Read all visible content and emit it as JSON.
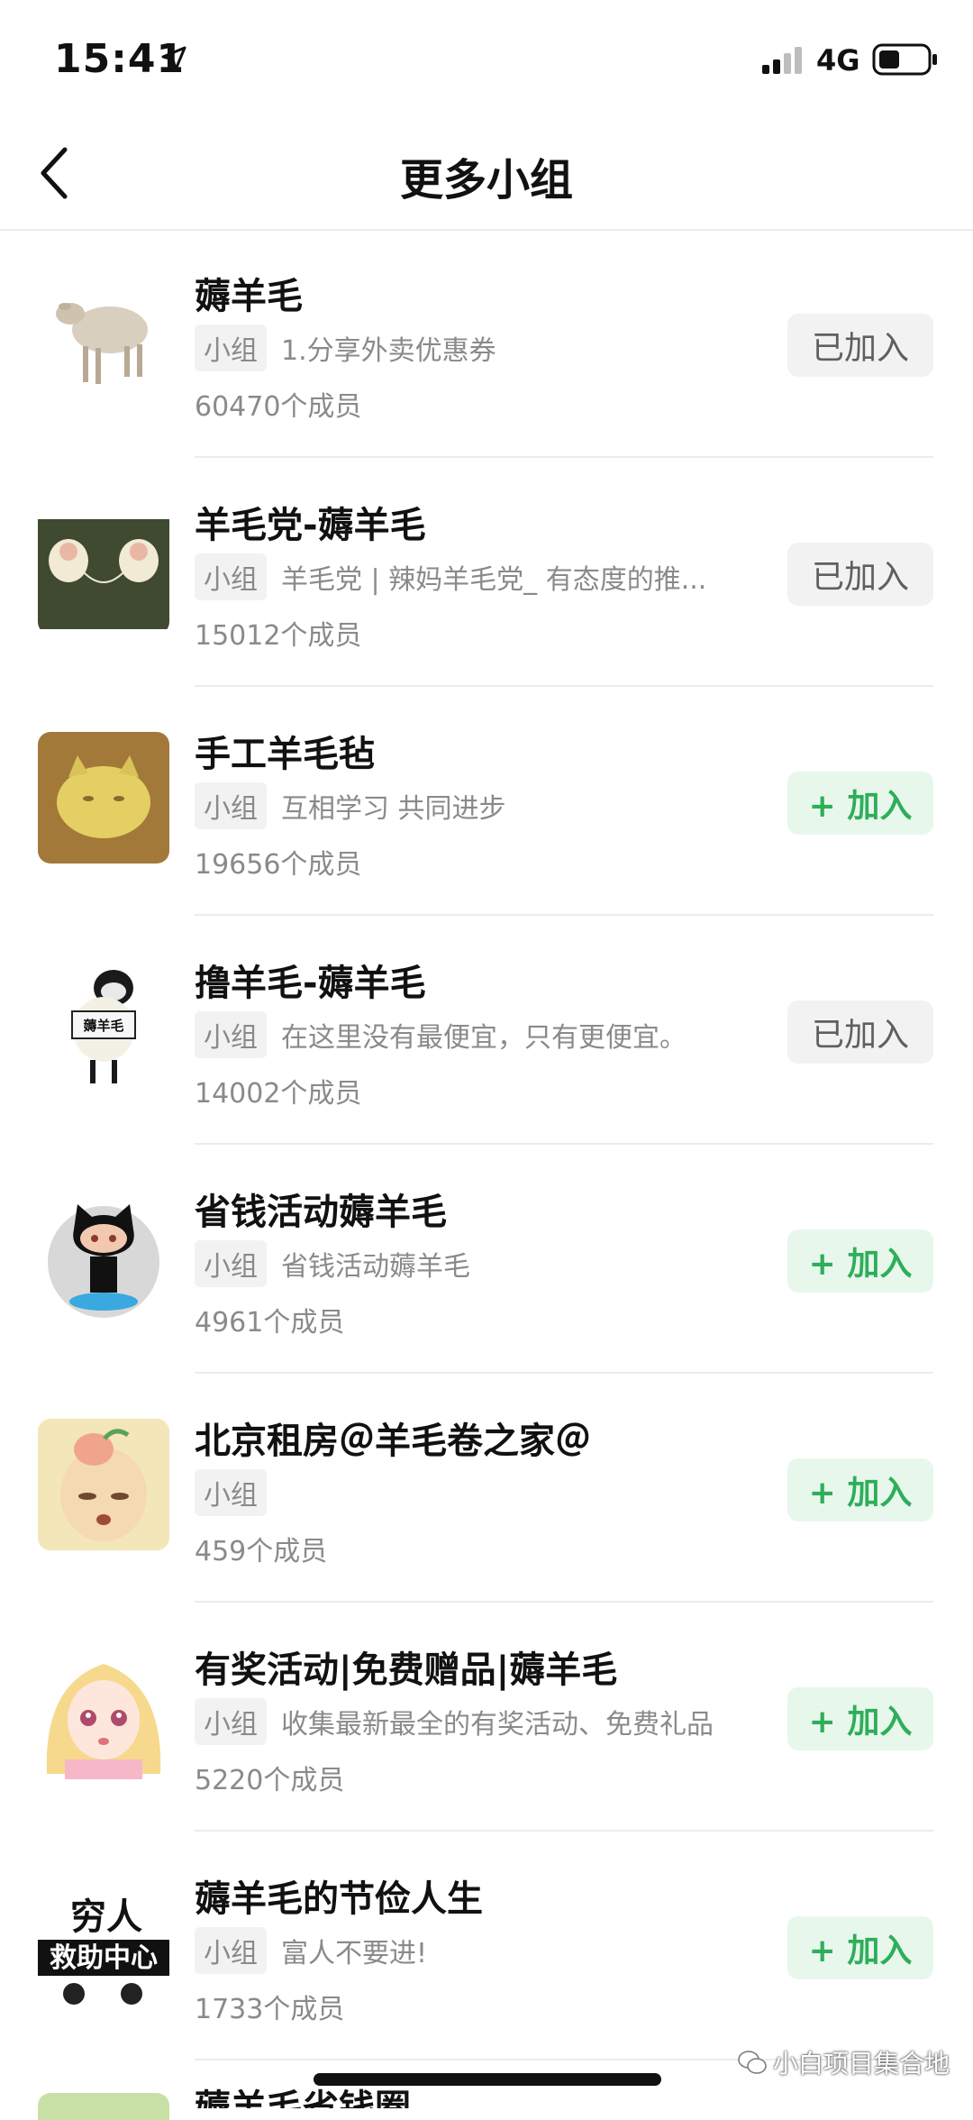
{
  "status_bar": {
    "time": "15:41",
    "network": "4G"
  },
  "nav": {
    "title": "更多小组"
  },
  "groups": [
    {
      "name": "薅羊毛",
      "tag": "小组",
      "desc": "1.分享外卖优惠券",
      "members": "60470个成员",
      "button": "已加入",
      "joined": true,
      "avatar": "sheep-photo"
    },
    {
      "name": "羊毛党-薅羊毛",
      "tag": "小组",
      "desc": "羊毛党 | 辣妈羊毛党_ 有态度的推...",
      "members": "15012个成员",
      "button": "已加入",
      "joined": true,
      "avatar": "sheep-knitting"
    },
    {
      "name": "手工羊毛毡",
      "tag": "小组",
      "desc": "互相学习 共同进步",
      "members": "19656个成员",
      "button": "+ 加入",
      "joined": false,
      "avatar": "felt-cat"
    },
    {
      "name": "撸羊毛-薅羊毛",
      "tag": "小组",
      "desc": "在这里没有最便宜，只有更便宜。",
      "members": "14002个成员",
      "button": "已加入",
      "joined": true,
      "avatar": "cartoon-sheep-sign"
    },
    {
      "name": "省钱活动薅羊毛",
      "tag": "小组",
      "desc": "省钱活动薅羊毛",
      "members": "4961个成员",
      "button": "+ 加入",
      "joined": false,
      "avatar": "octocat"
    },
    {
      "name": "北京租房＠羊毛卷之家＠",
      "tag": "小组",
      "desc": "",
      "members": "459个成员",
      "button": "+ 加入",
      "joined": false,
      "avatar": "peach-face"
    },
    {
      "name": "有奖活动|免费赠品|薅羊毛",
      "tag": "小组",
      "desc": "收集最新最全的有奖活动、免费礼品",
      "members": "5220个成员",
      "button": "+ 加入",
      "joined": false,
      "avatar": "anime-girl"
    },
    {
      "name": "薅羊毛的节俭人生",
      "tag": "小组",
      "desc": "富人不要进!",
      "members": "1733个成员",
      "button": "+ 加入",
      "joined": false,
      "avatar": "poor-help-center",
      "avatar_text_1": "穷人",
      "avatar_text_2": "救助中心"
    }
  ],
  "peek": {
    "name": "薅羊毛省钱圈"
  },
  "sign_text": "薅羊毛",
  "watermark": "小白项目集合地",
  "colors": {
    "join_green": "#2eae5a",
    "join_bg": "#e8f7ec",
    "joined_bg": "#f2f2f2"
  }
}
